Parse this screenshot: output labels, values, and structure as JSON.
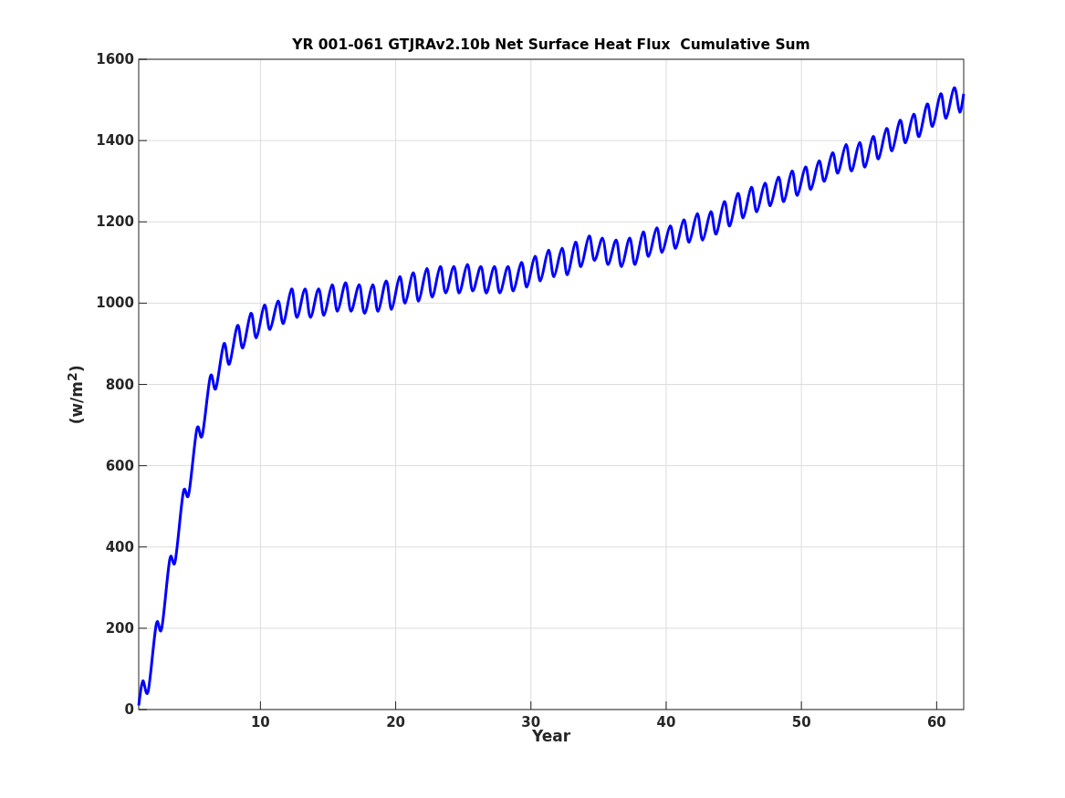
{
  "figure": {
    "chart_data": {
      "type": "line",
      "title": "YR 001-061 GTJRAv2.10b Net Surface Heat Flux  Cumulative Sum",
      "xlabel": "Year",
      "ylabel": "(w/m$^{2}$)",
      "x": [
        1,
        1.3,
        1.7,
        2.3,
        2.7,
        3.3,
        3.7,
        4.3,
        4.7,
        5.3,
        5.7,
        6.3,
        6.7,
        7.3,
        7.7,
        8.3,
        8.7,
        9.3,
        9.7,
        10.3,
        10.7,
        11.3,
        11.7,
        12.3,
        12.7,
        13.3,
        13.7,
        14.3,
        14.7,
        15.3,
        15.7,
        16.3,
        16.7,
        17.3,
        17.7,
        18.3,
        18.7,
        19.3,
        19.7,
        20.3,
        20.7,
        21.3,
        21.7,
        22.3,
        22.7,
        23.3,
        23.7,
        24.3,
        24.7,
        25.3,
        25.7,
        26.3,
        26.7,
        27.3,
        27.7,
        28.3,
        28.7,
        29.3,
        29.7,
        30.3,
        30.7,
        31.3,
        31.7,
        32.3,
        32.7,
        33.3,
        33.7,
        34.3,
        34.7,
        35.3,
        35.7,
        36.3,
        36.7,
        37.3,
        37.7,
        38.3,
        38.7,
        39.3,
        39.7,
        40.3,
        40.7,
        41.3,
        41.7,
        42.3,
        42.7,
        43.3,
        43.7,
        44.3,
        44.7,
        45.3,
        45.7,
        46.3,
        46.7,
        47.3,
        47.7,
        48.3,
        48.7,
        49.3,
        49.7,
        50.3,
        50.7,
        51.3,
        51.7,
        52.3,
        52.7,
        53.3,
        53.7,
        54.3,
        54.7,
        55.3,
        55.7,
        56.3,
        56.7,
        57.3,
        57.7,
        58.3,
        58.7,
        59.3,
        59.7,
        60.3,
        60.7,
        61.3,
        61.7,
        62
      ],
      "series": [
        {
          "color": "#0000ff",
          "values": [
            10,
            70,
            45,
            210,
            200,
            370,
            365,
            535,
            530,
            690,
            675,
            820,
            790,
            900,
            850,
            945,
            890,
            975,
            915,
            995,
            935,
            1005,
            950,
            1035,
            965,
            1035,
            965,
            1035,
            970,
            1045,
            980,
            1050,
            980,
            1045,
            975,
            1045,
            980,
            1055,
            985,
            1065,
            1000,
            1075,
            1005,
            1085,
            1015,
            1090,
            1025,
            1090,
            1025,
            1095,
            1030,
            1090,
            1025,
            1090,
            1025,
            1090,
            1030,
            1100,
            1040,
            1115,
            1055,
            1130,
            1065,
            1135,
            1070,
            1150,
            1090,
            1165,
            1105,
            1160,
            1095,
            1155,
            1090,
            1160,
            1095,
            1175,
            1115,
            1185,
            1125,
            1190,
            1135,
            1205,
            1150,
            1220,
            1155,
            1225,
            1170,
            1250,
            1190,
            1270,
            1210,
            1285,
            1225,
            1295,
            1240,
            1310,
            1250,
            1325,
            1265,
            1335,
            1280,
            1350,
            1300,
            1370,
            1320,
            1390,
            1325,
            1395,
            1335,
            1410,
            1355,
            1430,
            1375,
            1450,
            1395,
            1465,
            1410,
            1490,
            1435,
            1515,
            1455,
            1530,
            1470,
            1515
          ]
        }
      ],
      "grid": true,
      "xlim": [
        1,
        62
      ],
      "ylim": [
        0,
        1600
      ],
      "xticks": [
        10,
        20,
        30,
        40,
        50,
        60
      ],
      "yticks": [
        0,
        200,
        400,
        600,
        800,
        1000,
        1200,
        1400,
        1600
      ]
    }
  }
}
